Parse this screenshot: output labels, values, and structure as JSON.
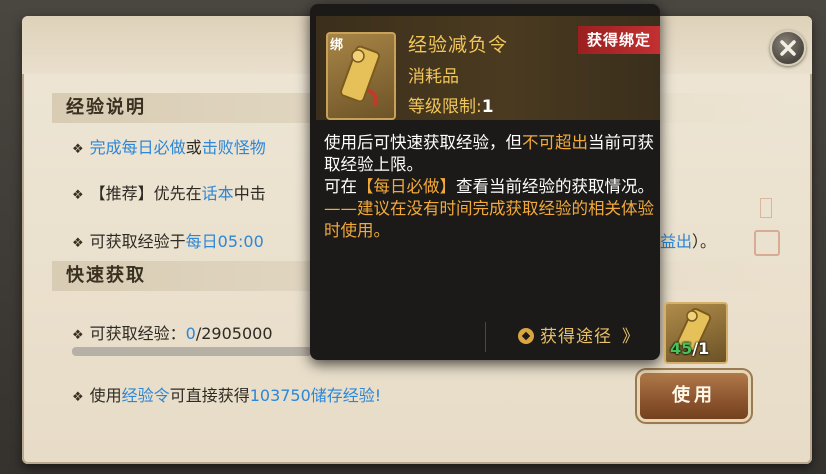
{
  "sections": {
    "explain_header": "经验说明",
    "quick_header": "快速获取"
  },
  "explain": {
    "line1_part1": "完成每日必做",
    "line1_part2": "或",
    "line1_part3": "击败怪物",
    "line2_part1": "【推荐】优先在",
    "line2_part2": "话本",
    "line2_part3": "中击",
    "line3_part1": "可获取经验于",
    "line3_part2": "每日05:00",
    "line3_tail_blue": "益出",
    "line3_tail": "）。"
  },
  "quick": {
    "exp_label": "可获取经验：",
    "exp_current": "0",
    "exp_max": "/2905000",
    "exp_progress_pct": 0,
    "use_line_part1": "使用",
    "use_line_part2": "经验令",
    "use_line_part3": "可直接获得",
    "use_line_part4": "103750储存经验!",
    "use_button": "使用"
  },
  "tooltip": {
    "item_icon_tag": "绑",
    "item_name": "经验减负令",
    "item_type": "消耗品",
    "level_label": "等级限制:",
    "level_value": "1",
    "bound_badge": "获得绑定",
    "desc_1a": "使用后可快速获取经验，但",
    "desc_1b": "不可超出",
    "desc_1c": "当前可获取经验上限。",
    "desc_2a": "可在",
    "desc_2b": "【每日必做】",
    "desc_2c": "查看当前经验的获取情况。",
    "desc_3": "——建议在没有时间完成获取经验的相关体验时使用。",
    "obtain_label": "获得途径",
    "obtain_arrow": "》"
  },
  "slot": {
    "have": "45",
    "need": "/1"
  },
  "colors": {
    "accent_blue": "#2c87d8",
    "tooltip_gold": "#f2c65a",
    "tooltip_highlight": "#f2a93b",
    "badge_red": "#c33030",
    "count_green": "#46c25a"
  },
  "icons": [
    "close-icon",
    "bullet-diamond-icon",
    "exp-token-icon",
    "obtain-coin-icon"
  ]
}
